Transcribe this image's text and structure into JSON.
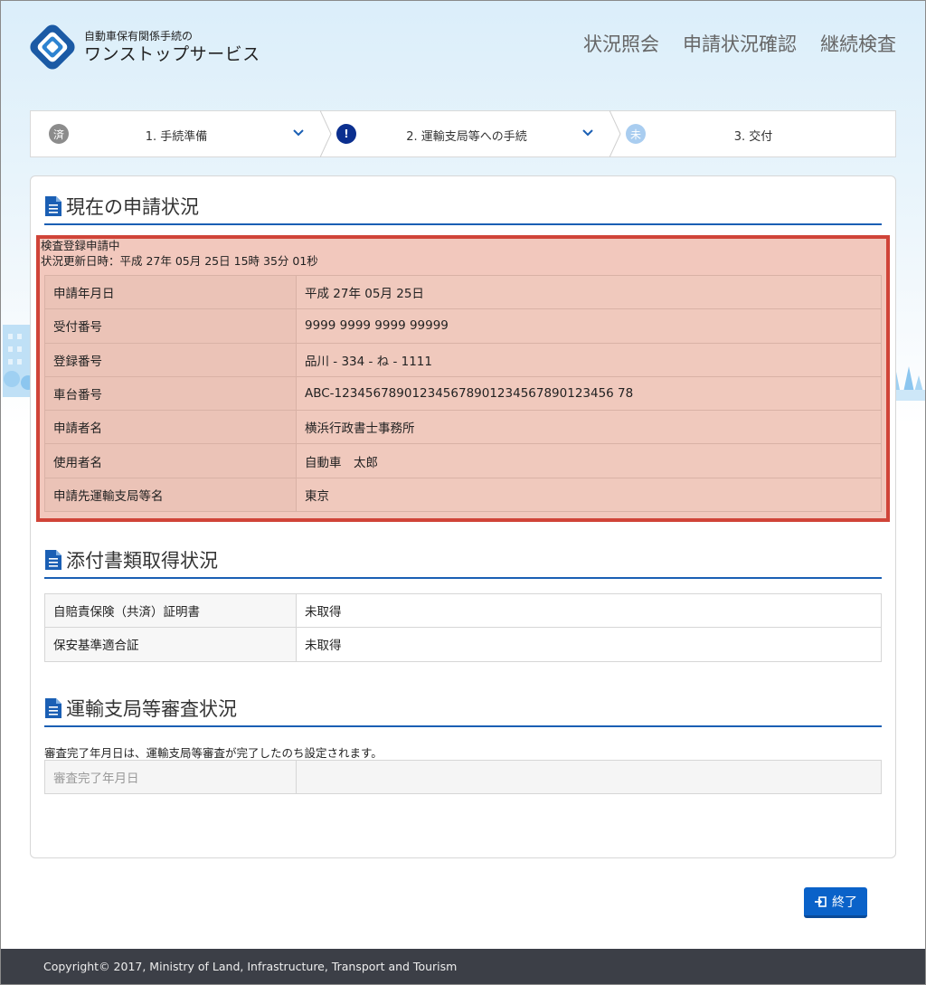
{
  "header": {
    "logo_sub": "自動車保有関係手続の",
    "logo_main": "ワンストップサービス",
    "nav": [
      "状況照会",
      "申請状況確認",
      "継続検査"
    ]
  },
  "steps": [
    {
      "badge": "済",
      "label": "1. 手続準備",
      "badge_color": "#8c8c8c"
    },
    {
      "badge": "!",
      "label": "2. 運輸支局等への手続",
      "badge_color": "#0b2f8f"
    },
    {
      "badge": "未",
      "label": "3. 交付",
      "badge_color": "#a9cdf0"
    }
  ],
  "current": {
    "title": "現在の申請状況",
    "status": "検査登録申請中",
    "updated": "状況更新日時：平成 27年 05月 25日 15時 35分 01秒",
    "rows": [
      {
        "key": "申請年月日",
        "value": "平成 27年 05月 25日"
      },
      {
        "key": "受付番号",
        "value": "9999 9999 9999 99999"
      },
      {
        "key": "登録番号",
        "value": "品川 - 334 - ね - 1111"
      },
      {
        "key": "車台番号",
        "value": "ABC-123456789012345678901234567890123456 78"
      },
      {
        "key": "申請者名",
        "value": "横浜行政書士事務所"
      },
      {
        "key": "使用者名",
        "value": "自動車　太郎"
      },
      {
        "key": "申請先運輸支局等名",
        "value": "東京"
      }
    ]
  },
  "attachments": {
    "title": "添付書類取得状況",
    "rows": [
      {
        "key": "自賠責保険（共済）証明書",
        "value": "未取得"
      },
      {
        "key": "保安基準適合証",
        "value": "未取得"
      }
    ]
  },
  "review": {
    "title": "運輸支局等審査状況",
    "note": "審査完了年月日は、運輸支局等審査が完了したのち設定されます。",
    "rows": [
      {
        "key": "審査完了年月日",
        "value": ""
      }
    ]
  },
  "end_button": "終了",
  "footer": "Copyright© 2017, Ministry of Land, Infrastructure, Transport and Tourism",
  "colors": {
    "accent": "#1a5fb4",
    "highlight_border": "#d04438",
    "footer_bg": "#3c3f47",
    "button": "#0a62c9"
  }
}
